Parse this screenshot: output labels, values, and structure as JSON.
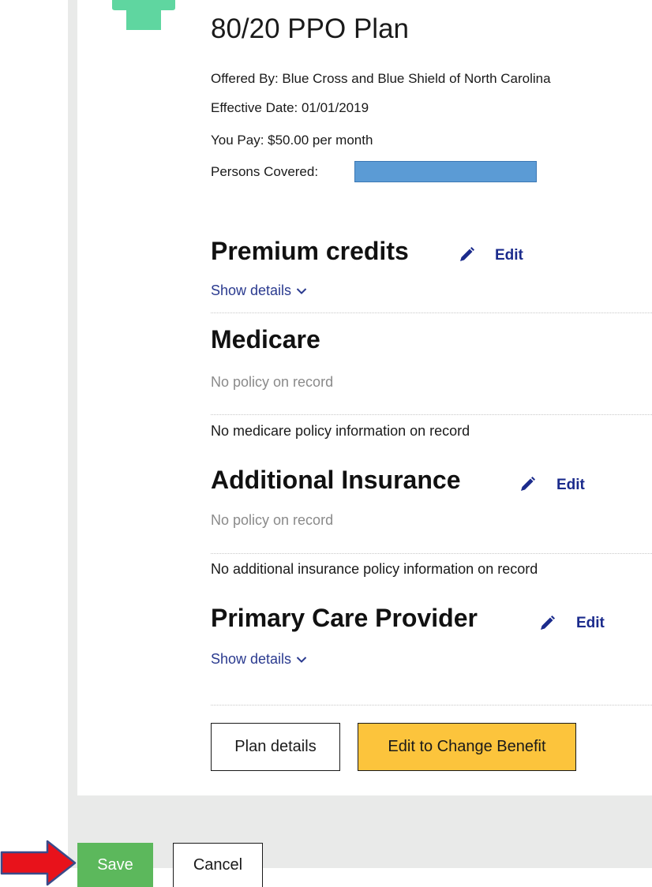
{
  "plan": {
    "title": "80/20 PPO Plan",
    "offered_by": "Offered By: Blue Cross and Blue Shield of North Carolina",
    "effective_date": "Effective Date: 01/01/2019",
    "you_pay": "You Pay: $50.00 per month",
    "persons_covered_label": "Persons Covered:"
  },
  "premium_credits": {
    "heading": "Premium credits",
    "edit_label": "Edit",
    "show_details": "Show details"
  },
  "medicare": {
    "heading": "Medicare",
    "status": "No policy on record",
    "info": "No medicare policy information on record"
  },
  "additional_insurance": {
    "heading": "Additional Insurance",
    "edit_label": "Edit",
    "status": "No policy on record",
    "info": "No additional insurance policy information on record"
  },
  "primary_care_provider": {
    "heading": "Primary Care Provider",
    "edit_label": "Edit",
    "show_details": "Show details"
  },
  "actions": {
    "plan_details": "Plan details",
    "edit_change_benefit": "Edit to Change Benefit"
  },
  "footer": {
    "save": "Save",
    "cancel": "Cancel"
  },
  "colors": {
    "edit_link": "#1b2b8c",
    "change_benefit_bg": "#fcc43c",
    "save_bg": "#5cb85c",
    "redaction": "#5b9bd5",
    "arrow": "#e8121b"
  },
  "icons": {
    "plan_icon": "green-plan-icon",
    "edit_icon": "pencil-icon",
    "expand_icon": "chevron-down-icon",
    "annotation": "red-arrow-icon"
  }
}
